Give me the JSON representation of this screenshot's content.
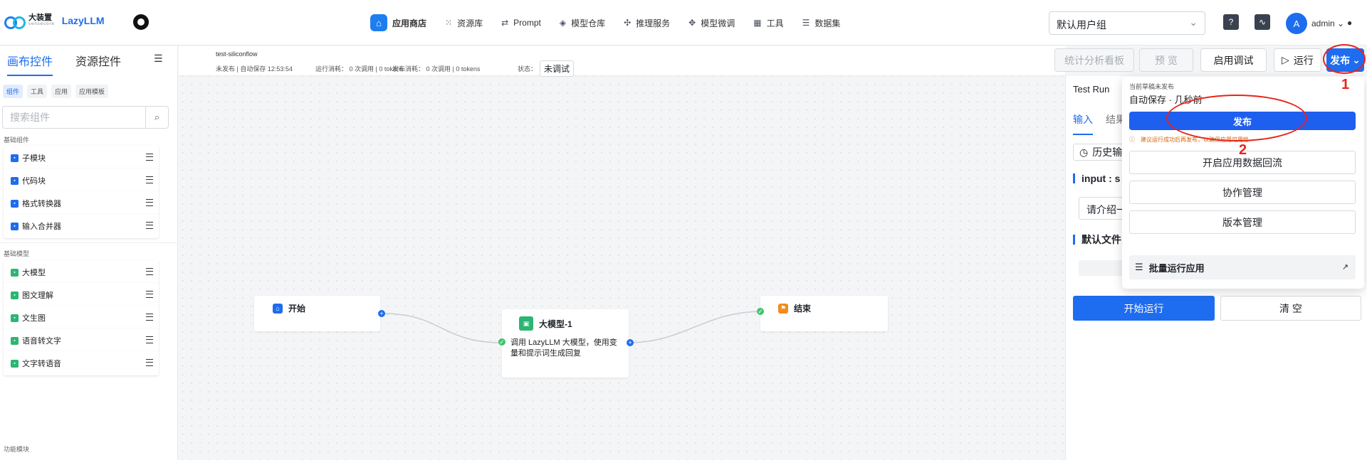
{
  "brand": {
    "logo_text": "大装置",
    "logo_sub": "sensecore",
    "app_name": "LazyLLM"
  },
  "nav": [
    {
      "label": "应用商店",
      "icon": "store-icon",
      "active": true
    },
    {
      "label": "资源库",
      "icon": "grid-icon"
    },
    {
      "label": "Prompt",
      "icon": "prompt-icon"
    },
    {
      "label": "模型仓库",
      "icon": "model-icon"
    },
    {
      "label": "推理服务",
      "icon": "inference-icon"
    },
    {
      "label": "模型微调",
      "icon": "finetune-icon"
    },
    {
      "label": "工具",
      "icon": "tools-icon"
    },
    {
      "label": "数据集",
      "icon": "dataset-icon"
    }
  ],
  "header": {
    "group_select": "默认用户组",
    "user_initial": "A",
    "username": "admin"
  },
  "left": {
    "tabs": [
      "画布控件",
      "资源控件"
    ],
    "chips": [
      "组件",
      "工具",
      "应用",
      "应用模板"
    ],
    "search_placeholder": "搜索组件",
    "section_basic": "基础组件",
    "basic": [
      "子模块",
      "代码块",
      "格式转换器",
      "输入合并器"
    ],
    "section_models": "基础模型",
    "models": [
      "大模型",
      "图文理解",
      "文生图",
      "语音转文字",
      "文字转语音"
    ],
    "section_func": "功能模块"
  },
  "app_info": {
    "name": "test-siliconflow",
    "status_line": "未发布 | 自动保存 12:53:54",
    "run_cost": "运行消耗： 0 次调用 | 0 tokens",
    "publish_cost": "发布消耗： 0 次调用 | 0 tokens",
    "state_label": "状态：",
    "state_value": "未调试"
  },
  "actions": {
    "analytics": "统计分析看板",
    "preview": "预 览",
    "debug": "启用调试",
    "run": "运行",
    "publish": "发布"
  },
  "nodes": {
    "start": "开始",
    "llm_title": "大模型-1",
    "llm_desc": "调用 LazyLLM 大模型，使用变量和提示词生成回复",
    "end": "结束"
  },
  "test_run": {
    "title": "Test Run",
    "tabs": [
      "输入",
      "结果"
    ],
    "history": "历史输",
    "input_label": "input : s",
    "input_value": "请介绍一",
    "default_file_label": "默认文件",
    "run_button": "开始运行",
    "clear_button": "清 空"
  },
  "publish_menu": {
    "note": "当前草稿未发布",
    "saved": "自动保存 · 几秒前",
    "publish_button": "发布",
    "warning": "建议运行成功后再发布，以确保应用可用性",
    "data_backflow": "开启应用数据回流",
    "collaboration": "协作管理",
    "versions": "版本管理",
    "batch_run": "批量运行应用"
  },
  "annotations": {
    "one": "1",
    "two": "2"
  },
  "colors": {
    "primary": "#1e6cf0",
    "annotation": "#e8241a",
    "success": "#3ec46d"
  }
}
